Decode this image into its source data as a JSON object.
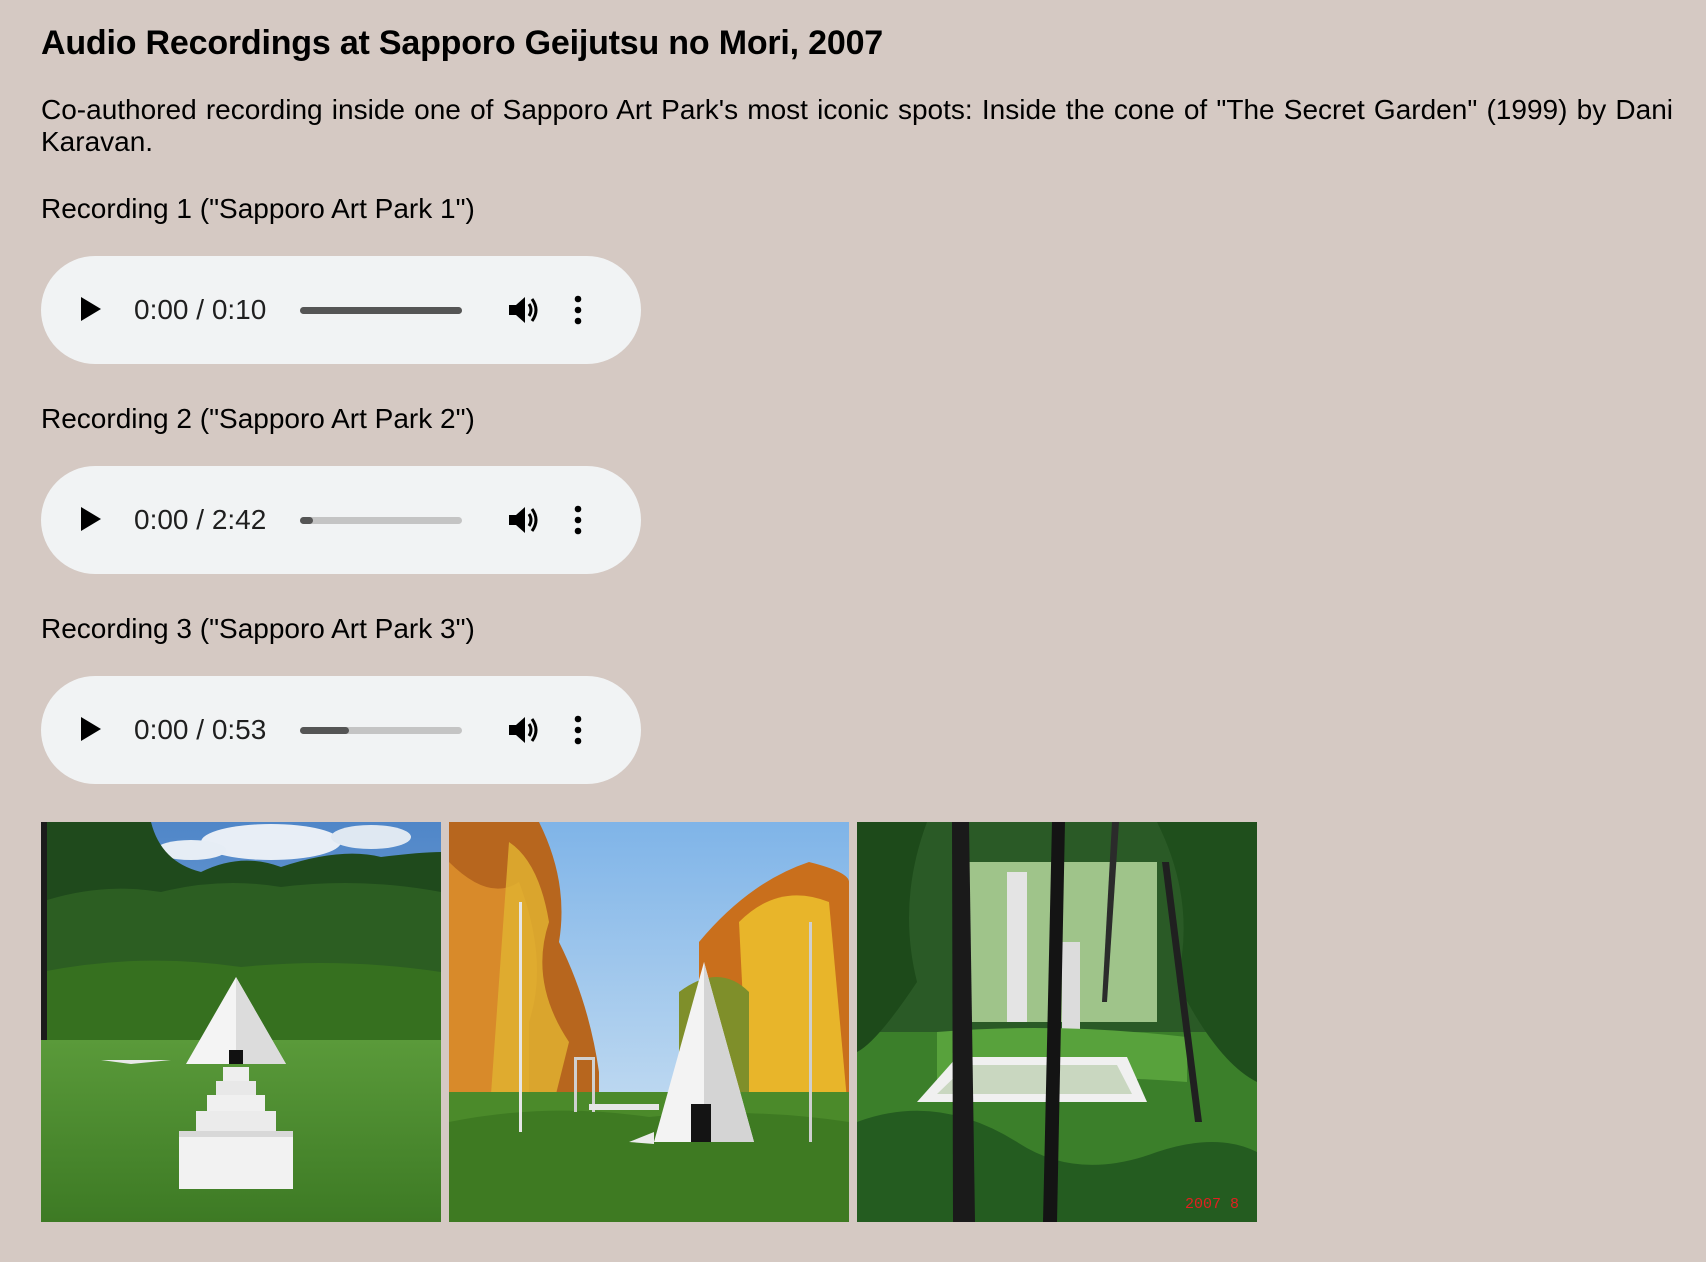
{
  "page": {
    "title": "Audio Recordings at Sapporo Geijutsu no Mori, 2007",
    "intro": "Co-authored recording inside one of Sapporo Art Park's most iconic spots: Inside the cone of \"The Secret Garden\" (1999) by Dani Karavan."
  },
  "recordings": [
    {
      "label": "Recording 1 (\"Sapporo Art Park 1\")",
      "time": "0:00 / 0:10",
      "buffered": 1.0
    },
    {
      "label": "Recording 2 (\"Sapporo Art Park 2\")",
      "time": "0:00 / 2:42",
      "buffered": 0.08
    },
    {
      "label": "Recording 3 (\"Sapporo Art Park 3\")",
      "time": "0:00 / 0:53",
      "buffered": 0.3
    }
  ],
  "player_icons": {
    "play": "play-icon",
    "volume": "volume-icon",
    "more": "more-options-icon"
  },
  "photos": [
    {
      "subject": "white cone and stepped pedestals on green lawn with forest"
    },
    {
      "subject": "white cone among autumn trees"
    },
    {
      "subject": "white walled garden seen through dark tree trunks",
      "date_stamp": "2007  8"
    }
  ],
  "colors": {
    "background": "#d5c9c3",
    "player_background": "#f1f3f4",
    "date_stamp": "#e02020"
  }
}
